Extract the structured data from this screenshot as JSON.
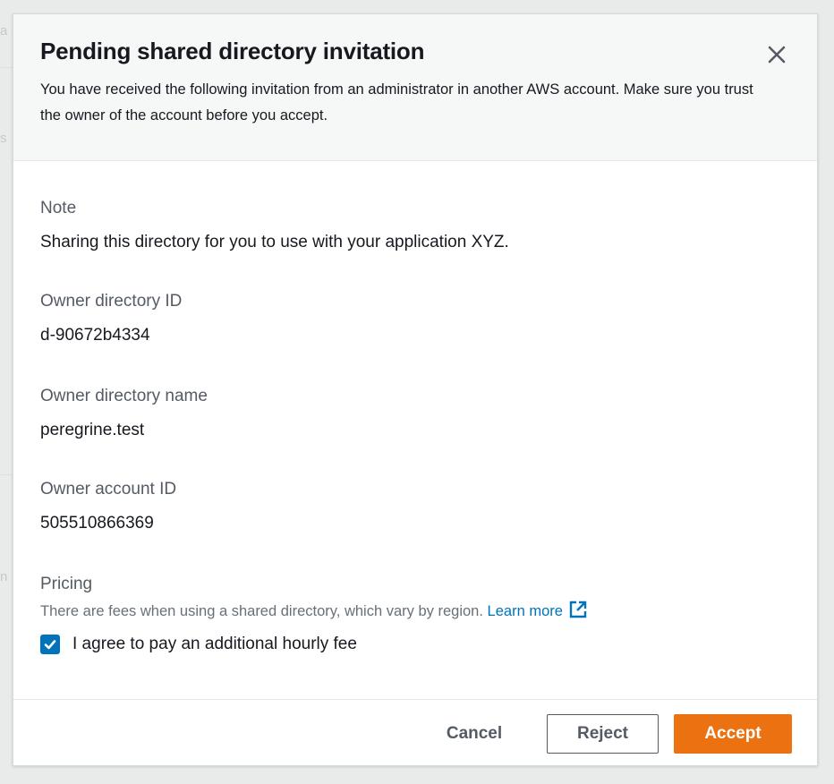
{
  "modal": {
    "title": "Pending shared directory invitation",
    "description": "You have received the following invitation from an administrator in another AWS account. Make sure you trust the owner of the account before you accept.",
    "close_icon": "close-icon"
  },
  "fields": {
    "note": {
      "label": "Note",
      "value": "Sharing this directory for you to use with your application XYZ."
    },
    "owner_directory_id": {
      "label": "Owner directory ID",
      "value": "d-90672b4334"
    },
    "owner_directory_name": {
      "label": "Owner directory name",
      "value": "peregrine.test"
    },
    "owner_account_id": {
      "label": "Owner account ID",
      "value": "505510866369"
    }
  },
  "pricing": {
    "label": "Pricing",
    "description": "There are fees when using a shared directory, which vary by region.",
    "learn_more": "Learn more",
    "external_icon": "external-link-icon",
    "checkbox_label": "I agree to pay an additional hourly fee",
    "checkbox_checked": true
  },
  "footer": {
    "cancel_label": "Cancel",
    "reject_label": "Reject",
    "accept_label": "Accept"
  },
  "colors": {
    "accent": "#ec7211",
    "link": "#0073bb",
    "checkbox": "#0073bb"
  }
}
